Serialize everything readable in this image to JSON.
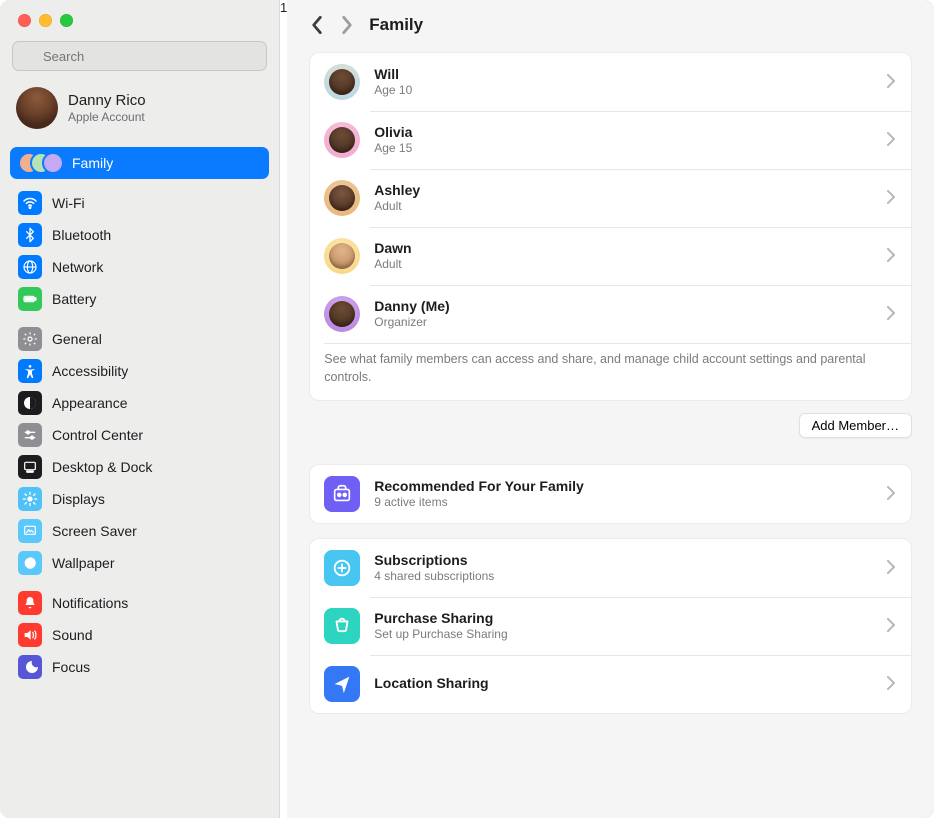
{
  "search": {
    "placeholder": "Search"
  },
  "account": {
    "name": "Danny Rico",
    "sub": "Apple Account"
  },
  "sidebar": {
    "group0": [
      {
        "label": "Family",
        "icon": "family",
        "selected": true
      }
    ],
    "group1": [
      {
        "label": "Wi-Fi",
        "icon": "wifi",
        "color": "#007aff"
      },
      {
        "label": "Bluetooth",
        "icon": "bluetooth",
        "color": "#007aff"
      },
      {
        "label": "Network",
        "icon": "network",
        "color": "#007aff"
      },
      {
        "label": "Battery",
        "icon": "battery",
        "color": "#34c759"
      }
    ],
    "group2": [
      {
        "label": "General",
        "icon": "gear",
        "color": "#8e8e93"
      },
      {
        "label": "Accessibility",
        "icon": "accessibility",
        "color": "#007aff"
      },
      {
        "label": "Appearance",
        "icon": "appearance",
        "color": "#1c1c1e"
      },
      {
        "label": "Control Center",
        "icon": "control-center",
        "color": "#8e8e93"
      },
      {
        "label": "Desktop & Dock",
        "icon": "desktop-dock",
        "color": "#1c1c1e"
      },
      {
        "label": "Displays",
        "icon": "displays",
        "color": "#4fc3f7"
      },
      {
        "label": "Screen Saver",
        "icon": "screen-saver",
        "color": "#5ac8fa"
      },
      {
        "label": "Wallpaper",
        "icon": "wallpaper",
        "color": "#5ac8fa"
      }
    ],
    "group3": [
      {
        "label": "Notifications",
        "icon": "notifications",
        "color": "#ff3b30"
      },
      {
        "label": "Sound",
        "icon": "sound",
        "color": "#ff3b30"
      },
      {
        "label": "Focus",
        "icon": "focus",
        "color": "#5856d6"
      }
    ]
  },
  "header": {
    "title": "Family"
  },
  "members": [
    {
      "name": "Will",
      "sub": "Age 10"
    },
    {
      "name": "Olivia",
      "sub": "Age 15"
    },
    {
      "name": "Ashley",
      "sub": "Adult"
    },
    {
      "name": "Dawn",
      "sub": "Adult"
    },
    {
      "name": "Danny (Me)",
      "sub": "Organizer"
    }
  ],
  "members_footnote": "See what family members can access and share, and manage child account settings and parental controls.",
  "add_member_label": "Add Member…",
  "sections_a": [
    {
      "title": "Recommended For Your Family",
      "sub": "9 active items",
      "icon": "recommended",
      "color": "#6f5ff5"
    }
  ],
  "sections_b": [
    {
      "title": "Subscriptions",
      "sub": "4 shared subscriptions",
      "icon": "subscriptions",
      "color": "#46c6f0"
    },
    {
      "title": "Purchase Sharing",
      "sub": "Set up Purchase Sharing",
      "icon": "purchase",
      "color": "#2dd4bf"
    },
    {
      "title": "Location Sharing",
      "sub": "",
      "icon": "location",
      "color": "#3478f6"
    }
  ]
}
